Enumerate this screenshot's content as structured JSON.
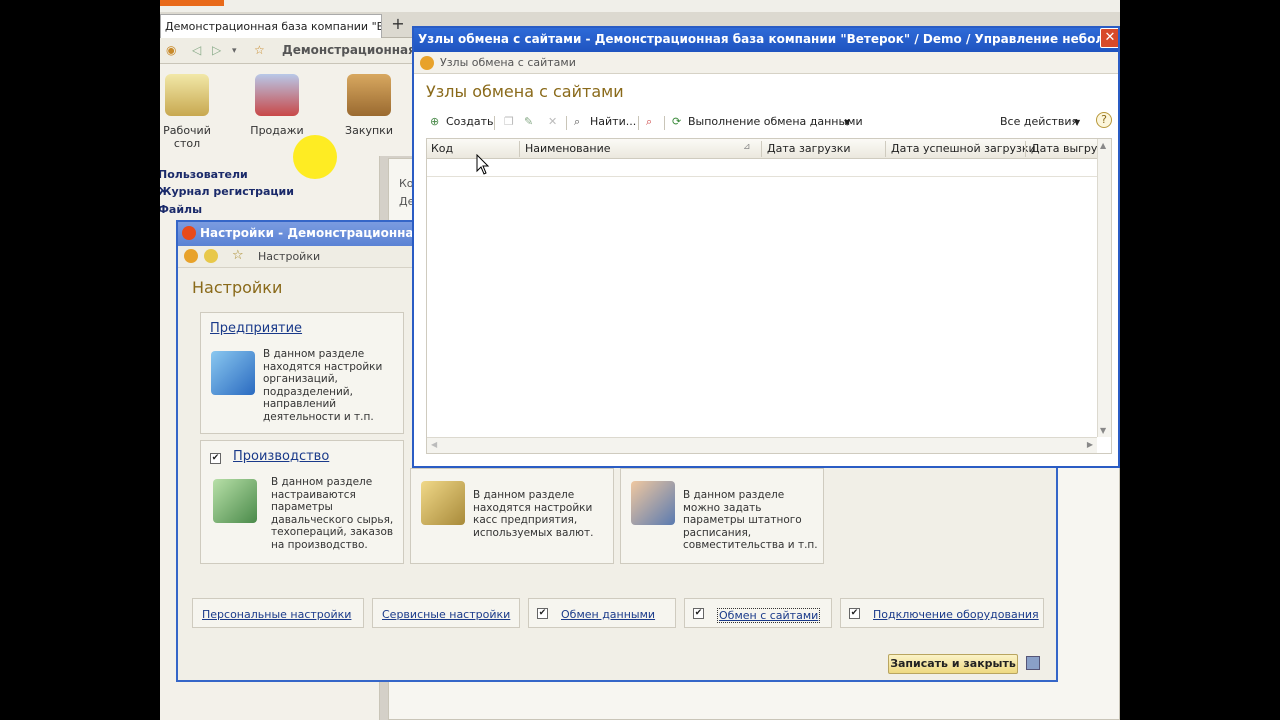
{
  "main": {
    "tab_title": "Демонстрационная база компании \"Ветер...",
    "nav_title": "Демонстрационная б",
    "sections": [
      {
        "label": "Рабочий стол"
      },
      {
        "label": "Продажи"
      },
      {
        "label": "Закупки"
      }
    ],
    "left_links": [
      "Пользователи",
      "Журнал регистрации",
      "Файлы"
    ],
    "left_small": [
      "Ко",
      "Де"
    ]
  },
  "settings": {
    "window_title": "Настройки - Демонстрационная б",
    "breadcrumb": "Настройки",
    "heading": "Настройки",
    "cards": [
      {
        "title": "Предприятие",
        "desc": "В данном разделе находятся настройки организаций, подразделений, направлений деятельности и т.п.",
        "checked": false
      },
      {
        "title": "Производство",
        "desc": "В данном разделе настраиваются параметры давальческого сырья, техопераций, заказов на производство.",
        "checked": true
      },
      {
        "title": "",
        "desc": "В данном разделе находятся настройки касс предприятия, используемых валют."
      },
      {
        "title": "",
        "desc": "В данном разделе можно задать параметры штатного расписания, совместительства и т.п."
      }
    ],
    "links": [
      {
        "label": "Персональные настройки",
        "checked": null
      },
      {
        "label": "Сервисные настройки",
        "checked": null
      },
      {
        "label": "Обмен данными",
        "checked": true
      },
      {
        "label": "Обмен с сайтами",
        "checked": true
      },
      {
        "label": "Подключение оборудования",
        "checked": true
      }
    ],
    "save_label": "Записать и закрыть"
  },
  "nodes": {
    "window_title": "Узлы обмена с сайтами - Демонстрационная база компании \"Ветерок\" / Demo / Управление небольшой ф...",
    "breadcrumb": "Узлы обмена с сайтами",
    "heading": "Узлы обмена с сайтами",
    "toolbar": {
      "create": "Создать",
      "find": "Найти...",
      "exchange": "Выполнение обмена данными",
      "all_actions": "Все действия",
      "help": "?"
    },
    "columns": [
      "Код",
      "Наименование",
      "Дата загрузки",
      "Дата успешной загрузки",
      "Дата выгру"
    ]
  },
  "colors": {
    "titlebar_blue": "#1f54c0",
    "heading_gold": "#8a6a1a",
    "link_blue": "#1a3a8a",
    "save_yellow": "#eed980"
  }
}
